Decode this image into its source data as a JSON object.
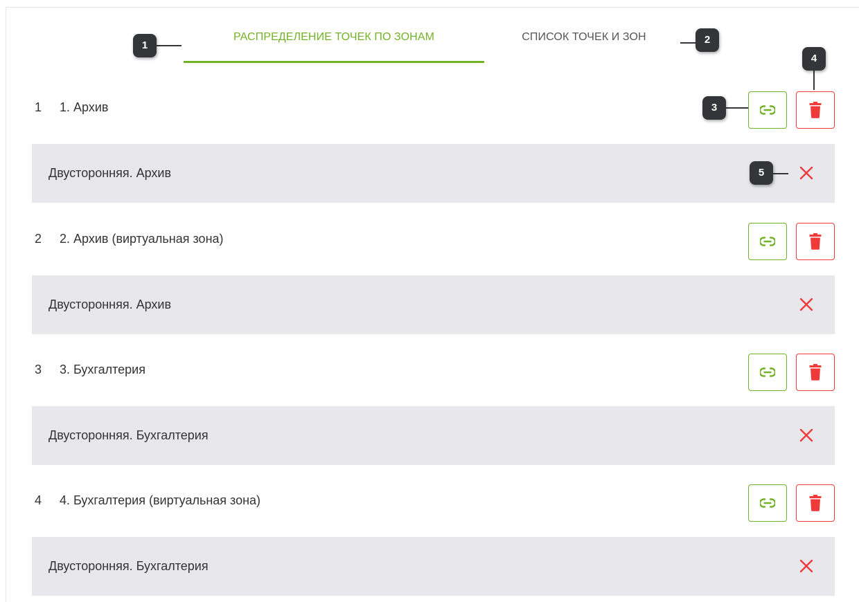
{
  "tabs": {
    "active_label": "РАСПРЕДЕЛЕНИЕ ТОЧЕК ПО ЗОНАМ",
    "inactive_label": "СПИСОК ТОЧЕК И ЗОН"
  },
  "badges": [
    "1",
    "2",
    "3",
    "4",
    "5"
  ],
  "zones": [
    {
      "index": "1",
      "name": "1. Архив",
      "point": "Двусторонняя. Архив"
    },
    {
      "index": "2",
      "name": "2. Архив (виртуальная зона)",
      "point": "Двусторонняя. Архив"
    },
    {
      "index": "3",
      "name": "3. Бухгалтерия",
      "point": "Двусторонняя. Бухгалтерия"
    },
    {
      "index": "4",
      "name": "4. Бухгалтерия (виртуальная зона)",
      "point": "Двусторонняя. Бухгалтерия"
    }
  ],
  "icons": {
    "link": "link-icon",
    "delete": "trash-icon",
    "remove": "close-icon"
  },
  "colors": {
    "accent_green": "#72b226",
    "danger_red": "#f03a3a",
    "badge_dark": "#333538",
    "point_row_bg": "#e8e8ec",
    "text": "#333333"
  }
}
